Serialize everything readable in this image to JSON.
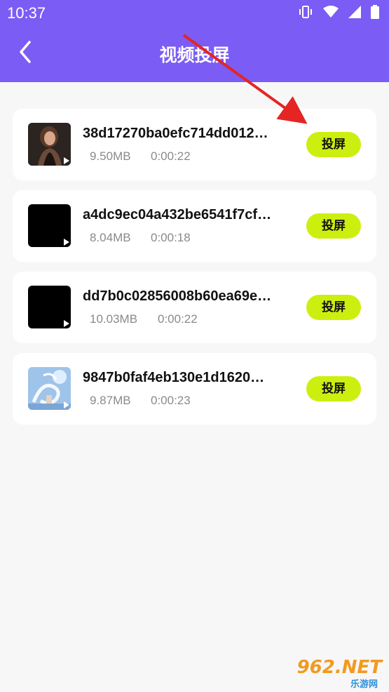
{
  "status_bar": {
    "time": "10:37"
  },
  "header": {
    "title": "视频投屏"
  },
  "colors": {
    "header": "#7b5cf5",
    "cast_button": "#cdef0f",
    "arrow": "#e52424"
  },
  "items": [
    {
      "name": "38d17270ba0efc714dd012…",
      "size": "9.50MB",
      "duration": "0:00:22",
      "button": "投屏",
      "thumb": "portrait-photo"
    },
    {
      "name": "a4dc9ec04a432be6541f7cf…",
      "size": "8.04MB",
      "duration": "0:00:18",
      "button": "投屏",
      "thumb": "black"
    },
    {
      "name": "dd7b0c02856008b60ea69e…",
      "size": "10.03MB",
      "duration": "0:00:22",
      "button": "投屏",
      "thumb": "black"
    },
    {
      "name": "9847b0faf4eb130e1d1620…",
      "size": "9.87MB",
      "duration": "0:00:23",
      "button": "投屏",
      "thumb": "dragon-art"
    }
  ],
  "watermark": {
    "main": "962.NET",
    "sub": "乐游网"
  }
}
